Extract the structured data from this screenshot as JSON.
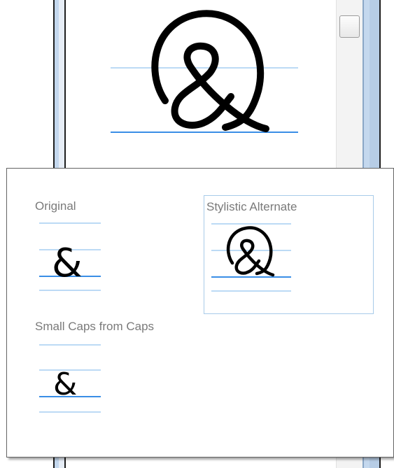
{
  "popup": {
    "options": [
      {
        "label": "Original",
        "glyph": "&",
        "selected": false
      },
      {
        "label": "Stylistic Alternate",
        "glyph": "alternate-ampersand",
        "selected": true
      },
      {
        "label": "Small Caps from Caps",
        "glyph": "&",
        "selected": false
      }
    ]
  },
  "colors": {
    "guide_line": "#a6cdf2",
    "baseline": "#3a8ee6",
    "glyph": "#000000",
    "selection_border": "#a8cbe9",
    "label_text": "#7a7a7a"
  }
}
